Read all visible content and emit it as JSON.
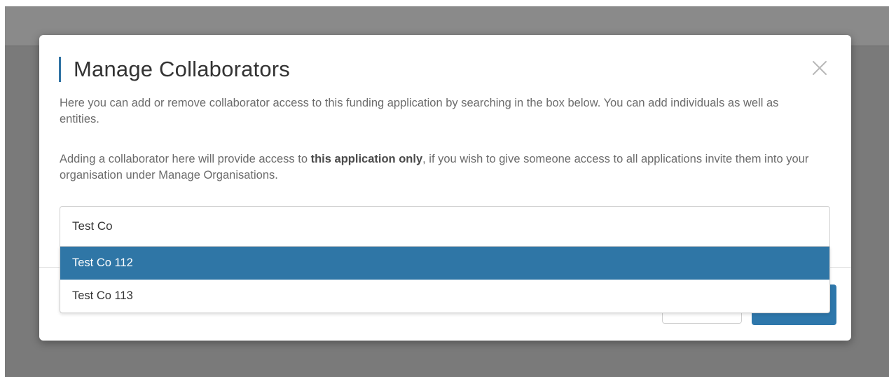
{
  "modal": {
    "title": "Manage Collaborators",
    "paragraph_1": "Here you can add or remove collaborator access to this funding application by searching in the box below. You can add individuals as well as entities.",
    "paragraph_2_before": "Adding a collaborator here will provide access to ",
    "paragraph_2_bold": "this application only",
    "paragraph_2_after": ", if you wish to give someone access to all applications invite them into your organisation under Manage Organisations.",
    "close_icon": "close-icon"
  },
  "search": {
    "value": "Test Co"
  },
  "dropdown": {
    "options": [
      {
        "label": "Test Co 112",
        "highlighted": true
      },
      {
        "label": "Test Co 113",
        "highlighted": false
      }
    ]
  },
  "colors": {
    "accent": "#2f72a3",
    "highlight": "#2f76a6",
    "backdrop": "#7a7a7a"
  }
}
